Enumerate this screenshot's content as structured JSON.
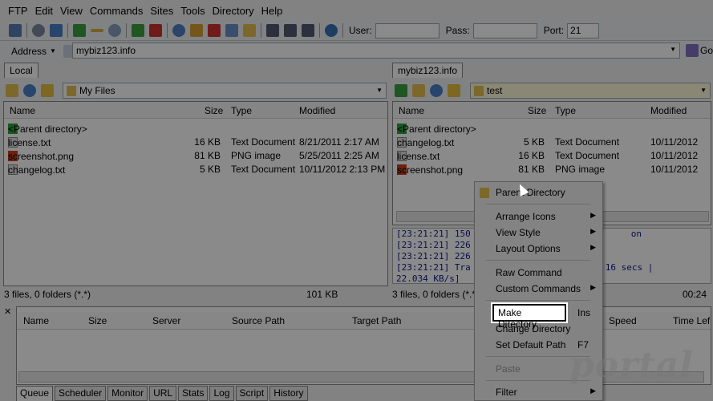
{
  "menubar": [
    "FTP",
    "Edit",
    "View",
    "Commands",
    "Sites",
    "Tools",
    "Directory",
    "Help"
  ],
  "toolbar": {
    "user_label": "User:",
    "pass_label": "Pass:",
    "port_label": "Port:",
    "user_value": "",
    "pass_value": "",
    "port_value": "21"
  },
  "address": {
    "label": "Address",
    "value": "mybiz123.info",
    "go_label": "Go"
  },
  "local": {
    "tab": "Local",
    "path": "My Files",
    "columns": [
      "Name",
      "Size",
      "Type",
      "Modified"
    ],
    "parent": "<Parent directory>",
    "files": [
      {
        "name": "license.txt",
        "size": "16 KB",
        "type": "Text Document",
        "modified": "8/21/2011 2:17 AM"
      },
      {
        "name": "screenshot.png",
        "size": "81 KB",
        "type": "PNG image",
        "modified": "5/25/2011 2:25 AM"
      },
      {
        "name": "changelog.txt",
        "size": "5 KB",
        "type": "Text Document",
        "modified": "10/11/2012 2:13 PM"
      }
    ],
    "status_left": "3 files, 0 folders (*.*)",
    "status_right": "101 KB"
  },
  "remote": {
    "tab": "mybiz123.info",
    "path": "test",
    "columns": [
      "Name",
      "Size",
      "Type",
      "Modified"
    ],
    "parent": "<Parent directory>",
    "files": [
      {
        "name": "changelog.txt",
        "size": "5 KB",
        "type": "Text Document",
        "modified": "10/11/2012"
      },
      {
        "name": "license.txt",
        "size": "16 KB",
        "type": "Text Document",
        "modified": "10/11/2012"
      },
      {
        "name": "screenshot.png",
        "size": "81 KB",
        "type": "PNG image",
        "modified": "10/11/2012"
      }
    ],
    "status_left": "3 files, 0 folders (*.*)",
    "status_right": "00:24"
  },
  "log": [
    {
      "time": "[23:21:21]",
      "text": "150",
      "tail": "on"
    },
    {
      "time": "[23:21:21]",
      "text": "226",
      "tail": ""
    },
    {
      "time": "[23:21:21]",
      "text": "226",
      "tail": ""
    },
    {
      "time": "[23:21:21]",
      "text": "Tra",
      "tail": "16 secs |"
    },
    {
      "time": "22.034 KB/s]",
      "text": "",
      "tail": ""
    }
  ],
  "queue": {
    "columns": [
      "Name",
      "Size",
      "Server",
      "Source Path",
      "Target Path",
      "Speed",
      "Time Lef"
    ],
    "tabs": [
      "Queue",
      "Scheduler",
      "Monitor",
      "URL",
      "Stats",
      "Log",
      "Script",
      "History"
    ]
  },
  "context_menu": {
    "items": [
      {
        "label": "Parent Directory",
        "shortcut": "",
        "submenu": false,
        "disabled": false
      },
      {
        "label": "Arrange Icons",
        "shortcut": "",
        "submenu": true,
        "disabled": false
      },
      {
        "label": "View Style",
        "shortcut": "",
        "submenu": true,
        "disabled": false
      },
      {
        "label": "Layout Options",
        "shortcut": "",
        "submenu": true,
        "disabled": false
      },
      {
        "label": "Raw Command",
        "shortcut": "",
        "submenu": false,
        "disabled": false
      },
      {
        "label": "Custom Commands",
        "shortcut": "",
        "submenu": true,
        "disabled": false
      },
      {
        "label": "Make Directory",
        "shortcut": "Ins",
        "submenu": false,
        "disabled": false
      },
      {
        "label": "Change Directory",
        "shortcut": "",
        "submenu": false,
        "disabled": false
      },
      {
        "label": "Set Default Path",
        "shortcut": "F7",
        "submenu": false,
        "disabled": false
      },
      {
        "label": "Paste",
        "shortcut": "",
        "submenu": false,
        "disabled": true
      },
      {
        "label": "Filter",
        "shortcut": "",
        "submenu": true,
        "disabled": false
      }
    ]
  },
  "watermark": "portal",
  "colors": {
    "folder": "#e8c050",
    "green_arrow": "#2fa03a",
    "log_text": "#0a1a8a",
    "overlay": "#000000"
  }
}
